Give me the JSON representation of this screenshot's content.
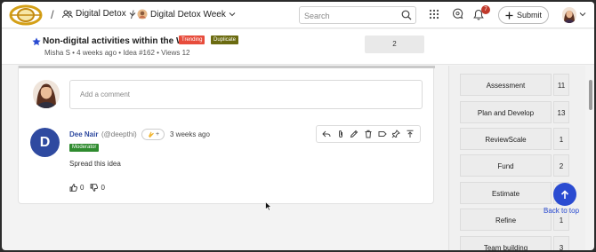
{
  "topbar": {
    "breadcrumbs": [
      {
        "label": "Digital Detox",
        "icon": "people-icon"
      },
      {
        "label": "Digital Detox Week",
        "icon": "community-avatar-icon"
      }
    ],
    "search": {
      "placeholder": "Search",
      "value": ""
    },
    "notification_count": "7",
    "submit_label": "Submit",
    "colors": {
      "badge": "#c0392b",
      "accent": "#2a4bd1"
    }
  },
  "idea": {
    "title": "Non-digital activities within the WS",
    "badges": {
      "trending": "Trending",
      "duplicate": "Duplicate"
    },
    "meta": "Misha S • 4 weeks ago • Idea #162 • Views 12",
    "votes": "2"
  },
  "comments": {
    "add_placeholder": "Add a comment",
    "items": [
      {
        "avatar_letter": "D",
        "name": "Dee Nair",
        "handle": "(@deepthi)",
        "time": "3 weeks ago",
        "role": "Moderator",
        "text": "Spread this idea",
        "upvotes": "0",
        "downvotes": "0",
        "reaction_plus": "+"
      }
    ]
  },
  "sidebar": {
    "stages": [
      {
        "label": "Assessment",
        "count": "11"
      },
      {
        "label": "Plan and Develop",
        "count": "13"
      },
      {
        "label": "ReviewScale",
        "count": "1"
      },
      {
        "label": "Fund",
        "count": "2"
      },
      {
        "label": "Estimate",
        "count": ""
      },
      {
        "label": "Refine",
        "count": "1"
      },
      {
        "label": "Team building",
        "count": "3"
      }
    ],
    "back_to_top": "Back to top"
  }
}
